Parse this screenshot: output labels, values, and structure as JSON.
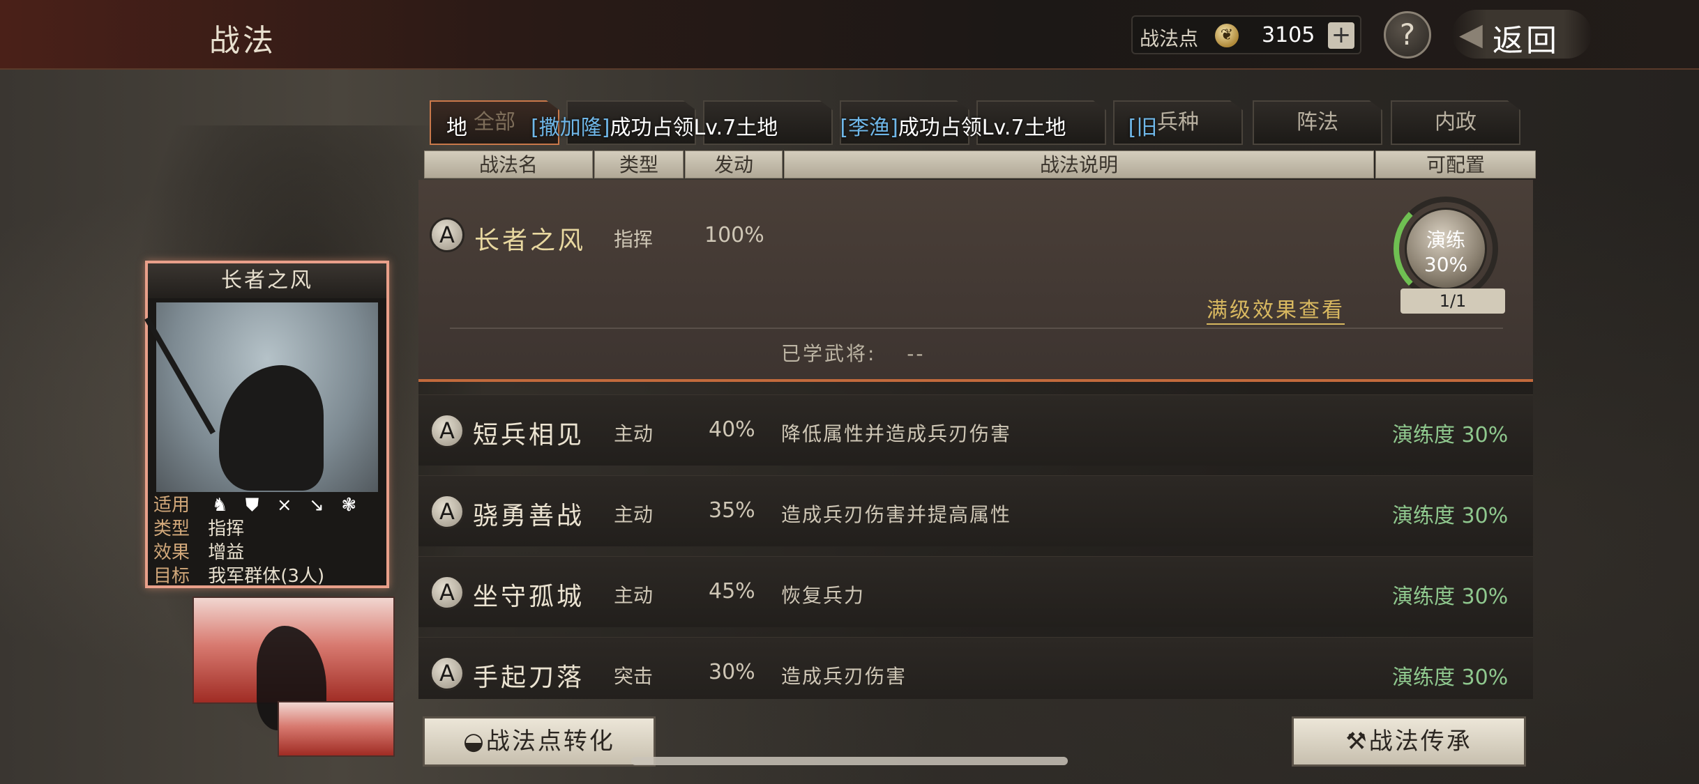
{
  "header": {
    "title": "战法",
    "points_label": "战法点",
    "points_value": "3105",
    "plus": "+",
    "help": "?",
    "back": "返回",
    "back_arrow": "◀"
  },
  "tabs": [
    "全部",
    "",
    "",
    "",
    "",
    "兵种",
    "阵法",
    "内政"
  ],
  "ticker": {
    "msg1_name": "[撒加隆]",
    "msg1_text": "成功占领Lv.7土地",
    "msg2_name": "[李渔]",
    "msg2_text": "成功占领Lv.7土地",
    "msg3_name": "[旧",
    "prefix": "地"
  },
  "columns": {
    "name": "战法名",
    "type": "类型",
    "trigger": "发动",
    "desc": "战法说明",
    "config": "可配置"
  },
  "expanded": {
    "grade": "A",
    "name": "长者之风",
    "type": "指挥",
    "rate": "100%",
    "full_effect": "满级效果查看",
    "learned_label": "已学武将:",
    "learned_value": "--",
    "drill_label": "演练",
    "drill_pct": "30%",
    "drill_count": "1/1",
    "drill_progress": 0.3
  },
  "rows": [
    {
      "grade": "A",
      "name": "短兵相见",
      "type": "主动",
      "rate": "40%",
      "desc": "降低属性并造成兵刃伤害",
      "prog": "演练度 30%"
    },
    {
      "grade": "A",
      "name": "骁勇善战",
      "type": "主动",
      "rate": "35%",
      "desc": "造成兵刃伤害并提高属性",
      "prog": "演练度 30%"
    },
    {
      "grade": "A",
      "name": "坐守孤城",
      "type": "主动",
      "rate": "45%",
      "desc": "恢复兵力",
      "prog": "演练度 30%"
    },
    {
      "grade": "A",
      "name": "手起刀落",
      "type": "突击",
      "rate": "30%",
      "desc": "造成兵刃伤害",
      "prog": "演练度 30%"
    }
  ],
  "card": {
    "title": "长者之风",
    "apply_label": "适用",
    "type_label": "类型",
    "type_value": "指挥",
    "effect_label": "效果",
    "effect_value": "增益",
    "target_label": "目标",
    "target_value": "我军群体(3人)"
  },
  "buttons": {
    "convert": "战法点转化",
    "inherit": "战法传承"
  },
  "colors": {
    "accent_orange": "#c26a3c",
    "progress_green": "#8fc88e",
    "player_name_blue": "#6fb7e8",
    "gold_link": "#d8b860"
  }
}
